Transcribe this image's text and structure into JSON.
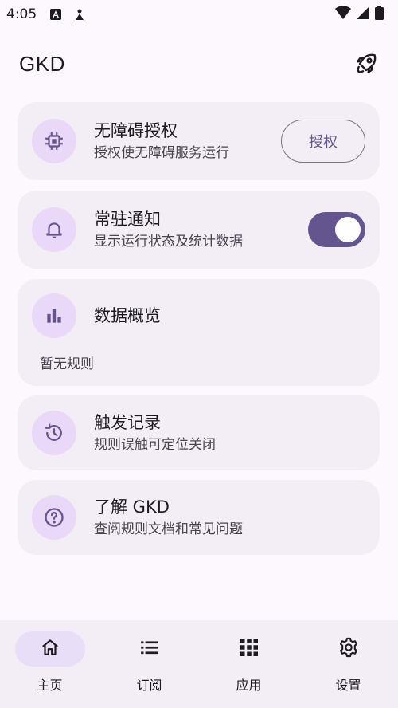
{
  "status_bar": {
    "time": "4:05"
  },
  "app_bar": {
    "title": "GKD",
    "action_icon": "rocket-icon"
  },
  "cards": {
    "accessibility": {
      "title": "无障碍授权",
      "subtitle": "授权使无障碍服务运行",
      "button": "授权",
      "icon": "chip-icon"
    },
    "notification": {
      "title": "常驻通知",
      "subtitle": "显示运行状态及统计数据",
      "enabled": true,
      "icon": "bell-icon"
    },
    "stats": {
      "title": "数据概览",
      "empty_text": "暂无规则",
      "icon": "bar-chart-icon"
    },
    "history": {
      "title": "触发记录",
      "subtitle": "规则误触可定位关闭",
      "icon": "history-icon"
    },
    "about": {
      "title": "了解 GKD",
      "subtitle": "查阅规则文档和常见问题",
      "icon": "help-icon"
    }
  },
  "bottom_nav": {
    "items": [
      {
        "label": "主页",
        "icon": "home-icon",
        "active": true
      },
      {
        "label": "订阅",
        "icon": "list-icon",
        "active": false
      },
      {
        "label": "应用",
        "icon": "apps-grid-icon",
        "active": false
      },
      {
        "label": "设置",
        "icon": "gear-icon",
        "active": false
      }
    ]
  },
  "colors": {
    "background": "#fdf7fe",
    "card": "#f3edf6",
    "primary": "#65558f",
    "icon_bg": "#ead8f9",
    "nav_active": "#e8def8"
  }
}
